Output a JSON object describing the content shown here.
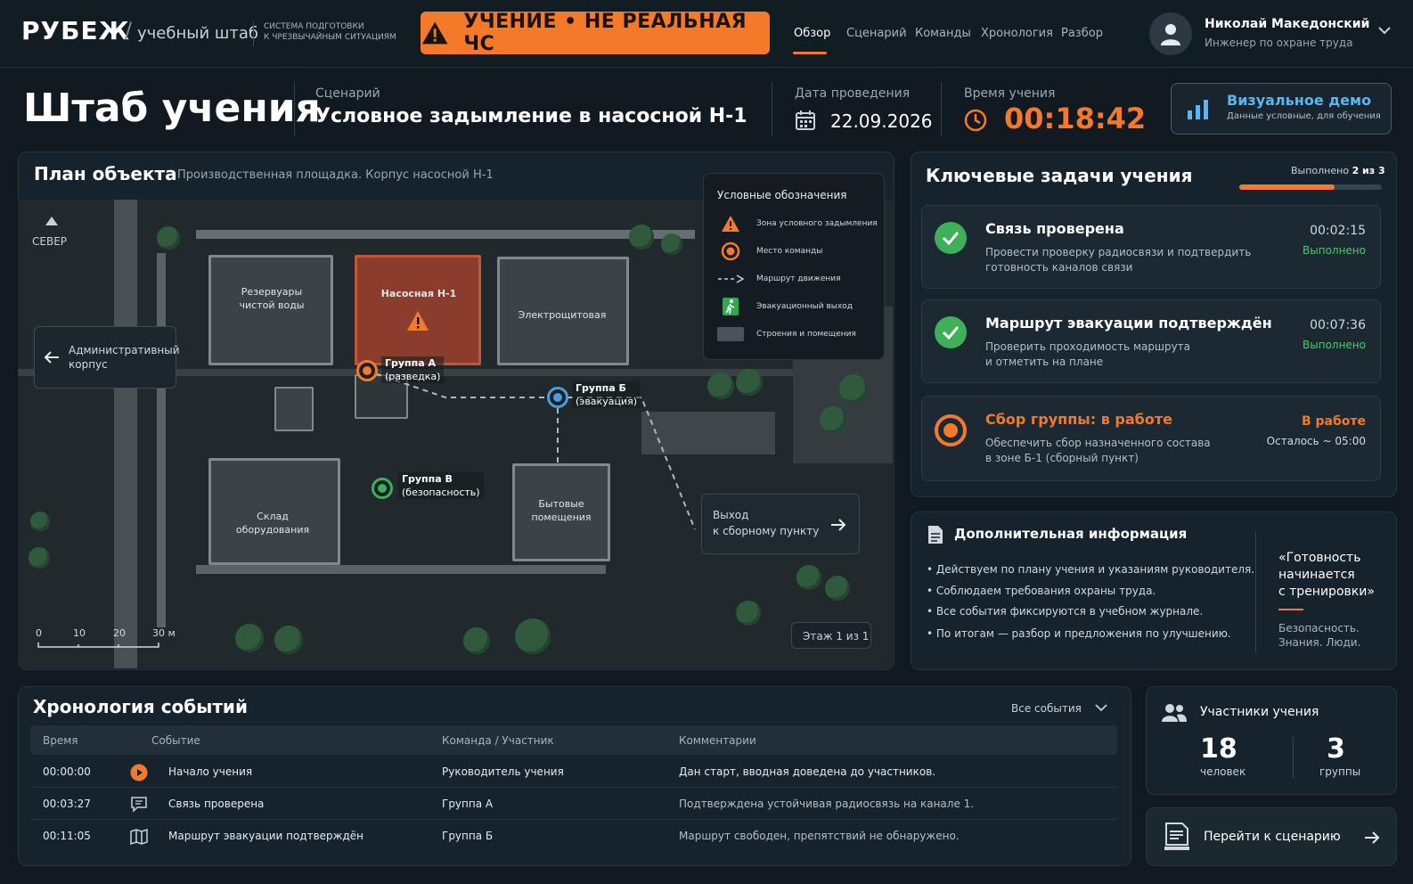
{
  "topbar": {
    "logo": "РУБЕЖ",
    "logo_sep": "/",
    "logo_sub": "учебный штаб",
    "logo_desc_1": "СИСТЕМА ПОДГОТОВКИ",
    "logo_desc_2": "К ЧРЕЗВЫЧАЙНЫМ СИТУАЦИЯМ",
    "drill_banner": "УЧЕНИЕ • НЕ РЕАЛЬНАЯ ЧС",
    "nav": [
      "Обзор",
      "Сценарий",
      "Команды",
      "Хронология",
      "Разбор"
    ],
    "user_name": "Николай Македонский",
    "user_role": "Инженер по охране труда"
  },
  "header": {
    "title": "Штаб учения",
    "scenario_label": "Сценарий",
    "scenario": "Условное задымление в насосной Н-1",
    "date_label": "Дата проведения",
    "date": "22.09.2026",
    "time_label": "Время учения",
    "time": "00:18:42",
    "demo_title": "Визуальное демо",
    "demo_sub": "Данные условные, для обучения"
  },
  "map": {
    "title": "План объекта",
    "subtitle": "Производственная площадка. Корпус насосной Н-1",
    "north": "СЕВЕР",
    "admin_1": "Административный",
    "admin_2": "корпус",
    "b_reservoirs_1": "Резервуары",
    "b_reservoirs_2": "чистой воды",
    "b_pump": "Насосная Н-1",
    "b_electro": "Электрощитовая",
    "b_storage_1": "Склад",
    "b_storage_2": "оборудования",
    "b_household_1": "Бытовые",
    "b_household_2": "помещения",
    "team_a_1": "Группа А",
    "team_a_2": "(разведка)",
    "team_b_1": "Группа Б",
    "team_b_2": "(эвакуация)",
    "team_v_1": "Группа В",
    "team_v_2": "(безопасность)",
    "exit_1": "Выход",
    "exit_2": "к сборному пункту",
    "scale": [
      "0",
      "10",
      "20",
      "30 м"
    ],
    "floor": "Этаж 1 из 1",
    "legend_title": "Условные обозначения",
    "legend": [
      "Зона условного задымления",
      "Место команды",
      "Маршрут движения",
      "Эвакуационный выход",
      "Строения и помещения"
    ]
  },
  "tasks": {
    "title": "Ключевые задачи учения",
    "progress_label": "Выполнено",
    "progress_value": "2 из 3",
    "progress_fraction": 0.67,
    "items": [
      {
        "title": "Связь проверена",
        "desc_1": "Провести проверку радиосвязи и подтвердить",
        "desc_2": "готовность каналов связи",
        "time": "00:02:15",
        "status": "Выполнено"
      },
      {
        "title": "Маршрут эвакуации подтверждён",
        "desc_1": "Проверить проходимость маршрута",
        "desc_2": "и отметить на плане",
        "time": "00:07:36",
        "status": "Выполнено"
      },
      {
        "title": "Сбор группы: в работе",
        "desc_1": "Обеспечить сбор назначенного состава",
        "desc_2": "в зоне Б-1 (сборный пункт)",
        "time": "В работе",
        "status": "Осталось ~ 05:00"
      }
    ]
  },
  "info": {
    "title": "Дополнительная информация",
    "items": [
      "Действуем по плану учения и указаниям руководителя.",
      "Соблюдаем требования охраны труда.",
      "Все события фиксируются в учебном журнале.",
      "По итогам — разбор и предложения по улучшению."
    ],
    "quote_1": "«Готовность",
    "quote_2": "начинается",
    "quote_3": "с тренировки»",
    "motto_1": "Безопасность.",
    "motto_2": "Знания. Люди."
  },
  "timeline": {
    "title": "Хронология событий",
    "filter": "Все события",
    "columns": [
      "Время",
      "Событие",
      "Команда / Участник",
      "Комментарии"
    ],
    "rows": [
      {
        "time": "00:00:00",
        "event": "Начало учения",
        "team": "Руководитель учения",
        "comment": "Дан старт, вводная доведена до участников."
      },
      {
        "time": "00:03:27",
        "event": "Связь проверена",
        "team": "Группа А",
        "comment": "Подтверждена устойчивая радиосвязь на канале 1."
      },
      {
        "time": "00:11:05",
        "event": "Маршрут эвакуации подтверждён",
        "team": "Группа Б",
        "comment": "Маршрут свободен, препятствий не обнаружено."
      }
    ]
  },
  "participants": {
    "title": "Участники учения",
    "people": "18",
    "people_label": "человек",
    "groups": "3",
    "groups_label": "группы"
  },
  "goto": {
    "label": "Перейти к сценарию"
  },
  "colors": {
    "accent": "#f47a2a",
    "success": "#3db058",
    "info": "#5ab6f2"
  }
}
